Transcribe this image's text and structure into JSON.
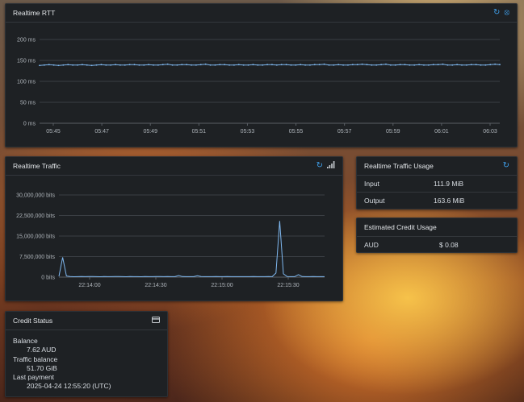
{
  "rtt_panel": {
    "title": "Realtime RTT",
    "icons": [
      "refresh-icon",
      "refresh-off-icon"
    ]
  },
  "traffic_panel": {
    "title": "Realtime Traffic",
    "icons": [
      "refresh-icon",
      "signal-bars-icon"
    ]
  },
  "usage_panel": {
    "title": "Realtime Traffic Usage",
    "rows": [
      {
        "label": "Input",
        "value": "111.9 MiB"
      },
      {
        "label": "Output",
        "value": "163.6 MiB"
      }
    ]
  },
  "credit_usage_panel": {
    "title": "Estimated Credit Usage",
    "currency": "AUD",
    "value": "$ 0.08"
  },
  "credit_status_panel": {
    "title": "Credit Status",
    "balance_label": "Balance",
    "balance_value": "7.62 AUD",
    "traffic_label": "Traffic balance",
    "traffic_value": "51.70 GiB",
    "payment_label": "Last payment",
    "payment_value": "2025-04-24 12:55:20 (UTC)"
  },
  "colors": {
    "panel_bg": "#1e2124",
    "accent": "#3fa0ec",
    "series_line": "#7fb8f0"
  },
  "chart_data": [
    {
      "type": "line",
      "x": [
        "05:45",
        "05:47",
        "05:49",
        "05:51",
        "05:53",
        "05:55",
        "05:57",
        "05:59",
        "06:01",
        "06:03"
      ],
      "xticks": [
        "05:45",
        "05:47",
        "05:49",
        "05:51",
        "05:53",
        "05:55",
        "05:57",
        "05:59",
        "06:01",
        "06:03"
      ],
      "yticks": [
        "0 ms",
        "50 ms",
        "100 ms",
        "150 ms",
        "200 ms"
      ],
      "ylim": [
        0,
        200
      ],
      "grid": true,
      "series": [
        {
          "values": [
            138,
            139,
            140,
            139,
            138,
            139,
            140,
            139,
            139,
            140,
            139,
            138,
            139,
            140,
            139,
            139,
            140,
            139,
            139,
            140,
            140,
            139,
            139,
            140,
            139,
            139,
            140,
            141,
            139,
            139,
            140,
            140,
            139,
            139,
            140,
            141,
            139,
            139,
            140,
            140,
            139,
            139,
            140,
            139,
            139,
            140,
            139,
            139,
            140,
            140,
            139,
            140,
            140,
            139,
            139,
            140,
            139,
            139,
            140,
            140,
            141,
            139,
            139,
            140,
            139,
            139,
            140,
            140,
            141,
            140,
            139,
            139,
            140,
            141,
            139,
            139,
            140,
            140,
            139,
            139,
            140,
            139,
            139,
            140,
            140,
            141,
            139,
            139,
            140,
            139,
            139,
            140,
            140,
            139,
            139,
            140,
            141,
            140
          ]
        }
      ]
    },
    {
      "type": "line",
      "x": [
        "22:13:50",
        "22:14:00",
        "22:14:10",
        "22:14:20",
        "22:14:30",
        "22:14:40",
        "22:14:50",
        "22:15:00",
        "22:15:10",
        "22:15:20",
        "22:15:30",
        "22:15:40"
      ],
      "xticks": [
        "22:14:00",
        "22:14:30",
        "22:15:00",
        "22:15:30"
      ],
      "yticks": [
        "0 bits",
        "7,500,000 bits",
        "15,000,000 bits",
        "22,500,000 bits",
        "30,000,000 bits"
      ],
      "ylim": [
        0,
        30000000
      ],
      "grid": true,
      "series": [
        {
          "values": [
            300000,
            7200000,
            400000,
            200000,
            150000,
            180000,
            200000,
            170000,
            200000,
            220000,
            180000,
            150000,
            200000,
            180000,
            170000,
            200000,
            220000,
            190000,
            150000,
            200000,
            180000,
            170000,
            160000,
            200000,
            190000,
            180000,
            200000,
            210000,
            190000,
            200000,
            180000,
            170000,
            600000,
            200000,
            190000,
            180000,
            170000,
            500000,
            200000,
            180000,
            190000,
            180000,
            200000,
            170000,
            180000,
            200000,
            180000,
            190000,
            180000,
            170000,
            190000,
            180000,
            200000,
            190000,
            180000,
            170000,
            200000,
            190000,
            1500000,
            20500000,
            1200000,
            200000,
            180000,
            190000,
            900000,
            200000,
            180000,
            190000,
            200000,
            180000,
            170000,
            190000
          ]
        }
      ]
    }
  ]
}
